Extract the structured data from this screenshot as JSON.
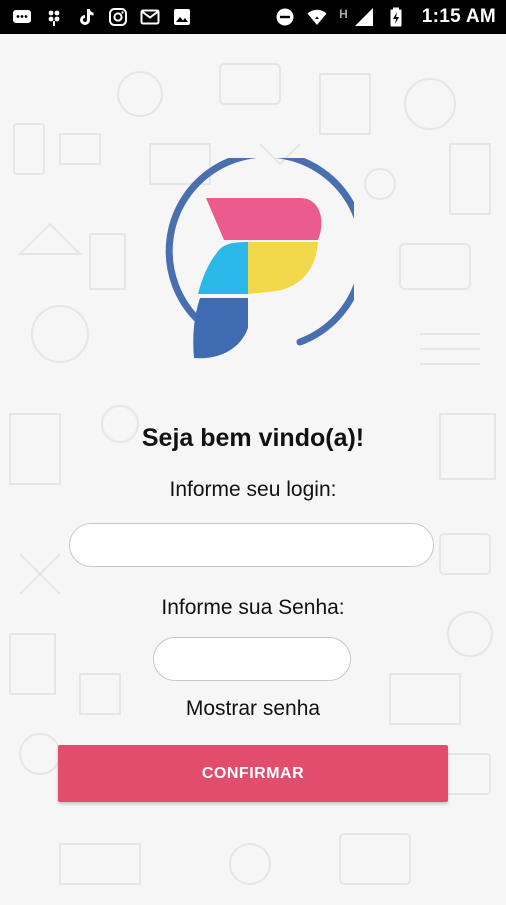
{
  "status_bar": {
    "time": "1:15 AM",
    "left_icons": [
      "chat-icon",
      "apps-icon",
      "tiktok-icon",
      "instagram-icon",
      "gmail-icon",
      "image-icon"
    ],
    "right_icons": [
      "do-not-disturb-icon",
      "wifi-icon",
      "network-type-h-icon",
      "signal-icon",
      "battery-icon"
    ],
    "network_type": "H"
  },
  "brand": {
    "logo_icon": "logo-p-icon",
    "colors": {
      "ring": "#4a6fae",
      "pink": "#ea5b8e",
      "yellow": "#f2d74a",
      "cyan": "#2bb8e8",
      "blue": "#3f6bb2"
    }
  },
  "login_screen": {
    "welcome": "Seja bem vindo(a)!",
    "login_label": "Informe seu login:",
    "login_value": "",
    "password_label": "Informe sua Senha:",
    "password_value": "",
    "show_password": "Mostrar senha",
    "confirm_button": "CONFIRMAR"
  },
  "theme": {
    "accent": "#e24d6d",
    "background": "#f6f6f6"
  }
}
